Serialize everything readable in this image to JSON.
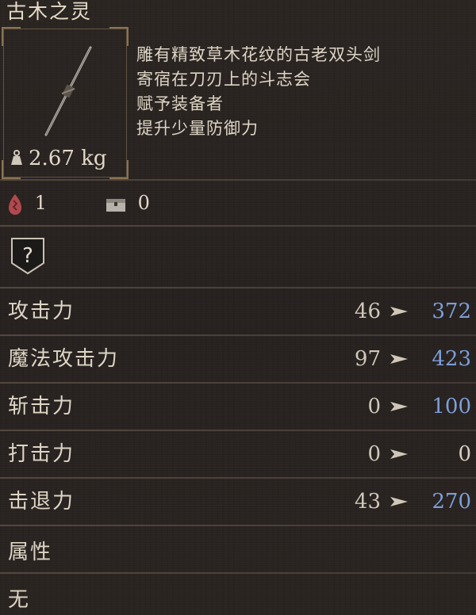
{
  "item": {
    "name": "古木之灵",
    "weight": "2.67 kg",
    "description": [
      "雕有精致草木花纹的古老双头剑",
      "寄宿在刀刃上的斗志会",
      "赋予装备者",
      "提升少量防御力"
    ],
    "counts": [
      {
        "icon": "bloodstain-icon",
        "value": "1"
      },
      {
        "icon": "chest-icon",
        "value": "0"
      }
    ],
    "affinity": {
      "icon": "question-mark-icon",
      "symbol": "?"
    }
  },
  "stats": [
    {
      "label": "攻击力",
      "base": "46",
      "new": "372",
      "improved": true
    },
    {
      "label": "魔法攻击力",
      "base": "97",
      "new": "423",
      "improved": true
    },
    {
      "label": "斩击力",
      "base": "0",
      "new": "100",
      "improved": true
    },
    {
      "label": "打击力",
      "base": "0",
      "new": "0",
      "improved": false
    },
    {
      "label": "击退力",
      "base": "43",
      "new": "270",
      "improved": true
    }
  ],
  "attribute": {
    "label": "属性",
    "value": "无"
  },
  "colors": {
    "improved": "#7d9fd8",
    "text": "#ddd5c5",
    "background": "#2a2522"
  }
}
